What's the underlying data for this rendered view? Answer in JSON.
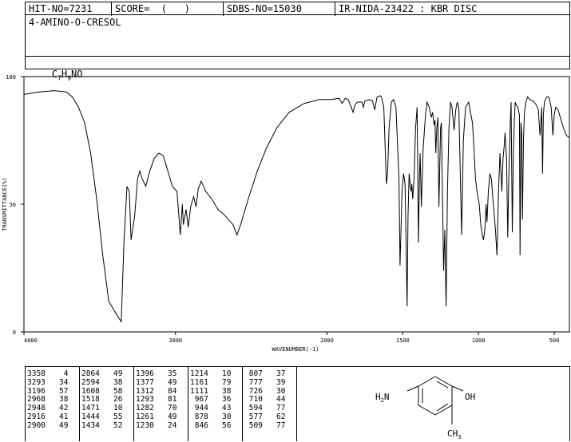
{
  "header": {
    "hit_no": "HIT-NO=7231",
    "score": "SCORE=  (   )",
    "sdbs_no": "SDBS-NO=15030",
    "ir_info": "IR-NIDA-23422 : KBR DISC"
  },
  "compound": {
    "name": "4-AMINO-O-CRESOL",
    "formula": "C7H9NO",
    "formula_parts": [
      "C",
      "7",
      "H",
      "9",
      "NO"
    ]
  },
  "chart_data": {
    "type": "line",
    "xlabel": "WAVENUMBER(-1)",
    "ylabel": "TRANSMITTANCE(%)",
    "xlim": [
      4000,
      400
    ],
    "ylim": [
      0,
      100
    ],
    "x_ticks": [
      4000,
      3000,
      2000,
      1500,
      1000,
      500
    ],
    "y_ticks": [
      0,
      50,
      100
    ],
    "series": [
      {
        "points": [
          [
            4000,
            93
          ],
          [
            3900,
            94
          ],
          [
            3800,
            94.5
          ],
          [
            3720,
            94
          ],
          [
            3680,
            92
          ],
          [
            3640,
            88
          ],
          [
            3600,
            82
          ],
          [
            3560,
            70
          ],
          [
            3520,
            52
          ],
          [
            3480,
            30
          ],
          [
            3440,
            12
          ],
          [
            3380,
            6
          ],
          [
            3358,
            4
          ],
          [
            3340,
            35
          ],
          [
            3320,
            57
          ],
          [
            3305,
            55
          ],
          [
            3293,
            36
          ],
          [
            3270,
            45
          ],
          [
            3250,
            60
          ],
          [
            3235,
            63
          ],
          [
            3220,
            60
          ],
          [
            3196,
            57
          ],
          [
            3170,
            63
          ],
          [
            3140,
            68
          ],
          [
            3110,
            70
          ],
          [
            3080,
            69
          ],
          [
            3050,
            63
          ],
          [
            3020,
            57
          ],
          [
            2990,
            55
          ],
          [
            2968,
            38
          ],
          [
            2955,
            50
          ],
          [
            2948,
            42
          ],
          [
            2930,
            48
          ],
          [
            2916,
            41
          ],
          [
            2900,
            49
          ],
          [
            2880,
            53
          ],
          [
            2864,
            49
          ],
          [
            2850,
            56
          ],
          [
            2830,
            59
          ],
          [
            2800,
            55
          ],
          [
            2760,
            52
          ],
          [
            2720,
            48
          ],
          [
            2680,
            46
          ],
          [
            2620,
            42
          ],
          [
            2594,
            38
          ],
          [
            2570,
            42
          ],
          [
            2520,
            52
          ],
          [
            2460,
            63
          ],
          [
            2400,
            72
          ],
          [
            2330,
            80
          ],
          [
            2250,
            86
          ],
          [
            2150,
            89.5
          ],
          [
            2050,
            91
          ],
          [
            1970,
            91
          ],
          [
            1920,
            91.5
          ],
          [
            1900,
            89.5
          ],
          [
            1880,
            91.5
          ],
          [
            1860,
            91
          ],
          [
            1840,
            88
          ],
          [
            1828,
            86
          ],
          [
            1815,
            89
          ],
          [
            1800,
            90
          ],
          [
            1770,
            90
          ],
          [
            1760,
            88
          ],
          [
            1750,
            90.5
          ],
          [
            1720,
            91
          ],
          [
            1700,
            90.5
          ],
          [
            1685,
            87
          ],
          [
            1670,
            92
          ],
          [
            1650,
            92.5
          ],
          [
            1640,
            92
          ],
          [
            1625,
            88
          ],
          [
            1608,
            58
          ],
          [
            1600,
            62
          ],
          [
            1590,
            80
          ],
          [
            1575,
            90
          ],
          [
            1560,
            91
          ],
          [
            1545,
            88
          ],
          [
            1525,
            60
          ],
          [
            1518,
            26
          ],
          [
            1505,
            55
          ],
          [
            1495,
            62
          ],
          [
            1485,
            58
          ],
          [
            1471,
            10
          ],
          [
            1465,
            45
          ],
          [
            1458,
            62
          ],
          [
            1450,
            57
          ],
          [
            1444,
            55
          ],
          [
            1440,
            58
          ],
          [
            1434,
            52
          ],
          [
            1425,
            60
          ],
          [
            1415,
            80
          ],
          [
            1405,
            88
          ],
          [
            1396,
            35
          ],
          [
            1390,
            60
          ],
          [
            1385,
            70
          ],
          [
            1377,
            49
          ],
          [
            1365,
            72
          ],
          [
            1350,
            85
          ],
          [
            1340,
            90
          ],
          [
            1325,
            88
          ],
          [
            1312,
            84
          ],
          [
            1303,
            86
          ],
          [
            1293,
            81
          ],
          [
            1287,
            83
          ],
          [
            1282,
            70
          ],
          [
            1275,
            80
          ],
          [
            1268,
            84
          ],
          [
            1261,
            49
          ],
          [
            1250,
            80
          ],
          [
            1245,
            82
          ],
          [
            1230,
            24
          ],
          [
            1222,
            40
          ],
          [
            1214,
            10
          ],
          [
            1205,
            55
          ],
          [
            1195,
            80
          ],
          [
            1185,
            90
          ],
          [
            1175,
            88
          ],
          [
            1161,
            79
          ],
          [
            1150,
            87
          ],
          [
            1140,
            90
          ],
          [
            1130,
            88
          ],
          [
            1111,
            38
          ],
          [
            1100,
            75
          ],
          [
            1085,
            88
          ],
          [
            1065,
            90
          ],
          [
            1050,
            85
          ],
          [
            1040,
            82
          ],
          [
            1030,
            72
          ],
          [
            1020,
            60
          ],
          [
            1010,
            55
          ],
          [
            995,
            50
          ],
          [
            985,
            42
          ],
          [
            975,
            38
          ],
          [
            967,
            36
          ],
          [
            958,
            40
          ],
          [
            950,
            50
          ],
          [
            944,
            43
          ],
          [
            935,
            55
          ],
          [
            925,
            62
          ],
          [
            915,
            60
          ],
          [
            905,
            52
          ],
          [
            895,
            45
          ],
          [
            888,
            40
          ],
          [
            878,
            30
          ],
          [
            868,
            55
          ],
          [
            858,
            70
          ],
          [
            846,
            55
          ],
          [
            838,
            68
          ],
          [
            830,
            73
          ],
          [
            825,
            78
          ],
          [
            815,
            68
          ],
          [
            807,
            37
          ],
          [
            800,
            60
          ],
          [
            790,
            82
          ],
          [
            785,
            90
          ],
          [
            777,
            39
          ],
          [
            770,
            70
          ],
          [
            765,
            80
          ],
          [
            758,
            90
          ],
          [
            752,
            89
          ],
          [
            740,
            88
          ],
          [
            730,
            85
          ],
          [
            726,
            30
          ],
          [
            720,
            82
          ],
          [
            715,
            78
          ],
          [
            710,
            44
          ],
          [
            703,
            75
          ],
          [
            697,
            86
          ],
          [
            688,
            90
          ],
          [
            675,
            92
          ],
          [
            660,
            91
          ],
          [
            640,
            90.5
          ],
          [
            620,
            89
          ],
          [
            605,
            87
          ],
          [
            594,
            77
          ],
          [
            590,
            80
          ],
          [
            583,
            88
          ],
          [
            577,
            62
          ],
          [
            572,
            85
          ],
          [
            565,
            90
          ],
          [
            550,
            92
          ],
          [
            535,
            92
          ],
          [
            520,
            88
          ],
          [
            509,
            77
          ],
          [
            500,
            85
          ],
          [
            490,
            88
          ],
          [
            475,
            87
          ],
          [
            460,
            84
          ],
          [
            440,
            80
          ],
          [
            420,
            77
          ],
          [
            400,
            76
          ]
        ]
      }
    ]
  },
  "peak_table": {
    "columns": [
      [
        [
          "3358",
          "4"
        ],
        [
          "3293",
          "34"
        ],
        [
          "3196",
          "57"
        ],
        [
          "2968",
          "38"
        ],
        [
          "2948",
          "42"
        ],
        [
          "2916",
          "41"
        ],
        [
          "2900",
          "49"
        ]
      ],
      [
        [
          "2864",
          "49"
        ],
        [
          "2594",
          "38"
        ],
        [
          "1608",
          "58"
        ],
        [
          "1518",
          "26"
        ],
        [
          "1471",
          "10"
        ],
        [
          "1444",
          "55"
        ],
        [
          "1434",
          "52"
        ]
      ],
      [
        [
          "1396",
          "35"
        ],
        [
          "1377",
          "49"
        ],
        [
          "1312",
          "84"
        ],
        [
          "1293",
          "81"
        ],
        [
          "1282",
          "70"
        ],
        [
          "1261",
          "49"
        ],
        [
          "1230",
          "24"
        ]
      ],
      [
        [
          "1214",
          "10"
        ],
        [
          "1161",
          "79"
        ],
        [
          "1111",
          "38"
        ],
        [
          "967",
          "36"
        ],
        [
          "944",
          "43"
        ],
        [
          "878",
          "30"
        ],
        [
          "846",
          "56"
        ]
      ],
      [
        [
          "807",
          "37"
        ],
        [
          "777",
          "39"
        ],
        [
          "726",
          "30"
        ],
        [
          "710",
          "44"
        ],
        [
          "594",
          "77"
        ],
        [
          "577",
          "62"
        ],
        [
          "509",
          "77"
        ]
      ]
    ]
  },
  "structure": {
    "left_group": "H2N",
    "left_group_parts": [
      "H",
      "2",
      "N"
    ],
    "right_group": "OH",
    "bottom_group": "CH3",
    "bottom_group_parts": [
      "CH",
      "3"
    ]
  }
}
